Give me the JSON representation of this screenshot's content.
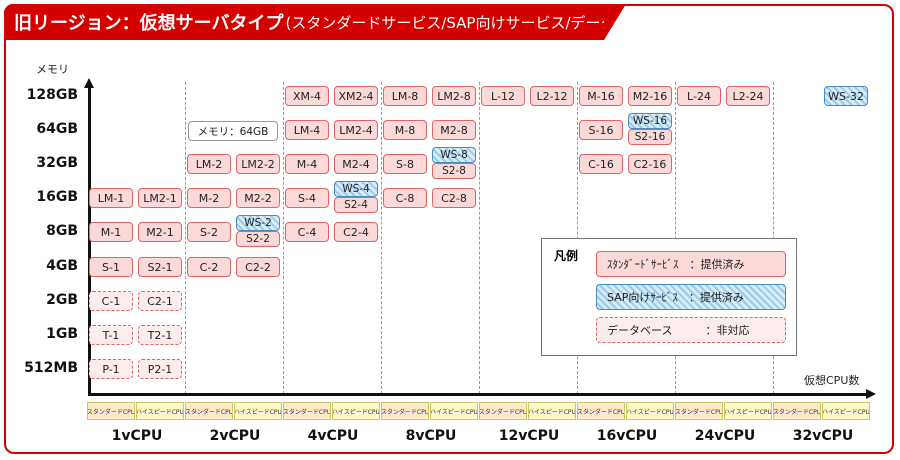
{
  "title": {
    "main": "旧リージョン：仮想サーバタイプ",
    "sub": "(スタンダードサービス/SAP向けサービス/データベース)"
  },
  "axes": {
    "y_label": "メモリ",
    "x_label": "仮想CPU数"
  },
  "memory_levels": [
    "128GB",
    "64GB",
    "32GB",
    "16GB",
    "8GB",
    "4GB",
    "2GB",
    "1GB",
    "512MB"
  ],
  "cpu_groups": [
    "1vCPU",
    "2vCPU",
    "4vCPU",
    "8vCPU",
    "12vCPU",
    "16vCPU",
    "24vCPU",
    "32vCPU"
  ],
  "cpu_subtypes": {
    "standard": "スタンダードCPU",
    "highspeed": "ハイスピードCPU"
  },
  "memory_note": "メモリ：64GB",
  "types": [
    {
      "label": "P-1",
      "kind": "db"
    },
    {
      "label": "P2-1",
      "kind": "db"
    },
    {
      "label": "T-1",
      "kind": "db"
    },
    {
      "label": "T2-1",
      "kind": "db"
    },
    {
      "label": "C-1",
      "kind": "db"
    },
    {
      "label": "C2-1",
      "kind": "db"
    },
    {
      "label": "S-1",
      "kind": "std"
    },
    {
      "label": "S2-1",
      "kind": "std"
    },
    {
      "label": "M-1",
      "kind": "std"
    },
    {
      "label": "M2-1",
      "kind": "std"
    },
    {
      "label": "LM-1",
      "kind": "std"
    },
    {
      "label": "LM2-1",
      "kind": "std"
    },
    {
      "label": "C-2",
      "kind": "std"
    },
    {
      "label": "C2-2",
      "kind": "std"
    },
    {
      "label": "S-2",
      "kind": "std"
    },
    {
      "label": "WS-2",
      "kind": "sap"
    },
    {
      "label": "S2-2",
      "kind": "std"
    },
    {
      "label": "M-2",
      "kind": "std"
    },
    {
      "label": "M2-2",
      "kind": "std"
    },
    {
      "label": "LM-2",
      "kind": "std"
    },
    {
      "label": "LM2-2",
      "kind": "std"
    },
    {
      "label": "C-4",
      "kind": "std"
    },
    {
      "label": "C2-4",
      "kind": "std"
    },
    {
      "label": "S-4",
      "kind": "std"
    },
    {
      "label": "WS-4",
      "kind": "sap"
    },
    {
      "label": "S2-4",
      "kind": "std"
    },
    {
      "label": "M-4",
      "kind": "std"
    },
    {
      "label": "M2-4",
      "kind": "std"
    },
    {
      "label": "LM-4",
      "kind": "std"
    },
    {
      "label": "LM2-4",
      "kind": "std"
    },
    {
      "label": "XM-4",
      "kind": "std"
    },
    {
      "label": "XM2-4",
      "kind": "std"
    },
    {
      "label": "C-8",
      "kind": "std"
    },
    {
      "label": "C2-8",
      "kind": "std"
    },
    {
      "label": "S-8",
      "kind": "std"
    },
    {
      "label": "WS-8",
      "kind": "sap"
    },
    {
      "label": "S2-8",
      "kind": "std"
    },
    {
      "label": "M-8",
      "kind": "std"
    },
    {
      "label": "M2-8",
      "kind": "std"
    },
    {
      "label": "LM-8",
      "kind": "std"
    },
    {
      "label": "LM2-8",
      "kind": "std"
    },
    {
      "label": "L-12",
      "kind": "std"
    },
    {
      "label": "L2-12",
      "kind": "std"
    },
    {
      "label": "C-16",
      "kind": "std"
    },
    {
      "label": "C2-16",
      "kind": "std"
    },
    {
      "label": "S-16",
      "kind": "std"
    },
    {
      "label": "WS-16",
      "kind": "sap"
    },
    {
      "label": "S2-16",
      "kind": "std"
    },
    {
      "label": "M-16",
      "kind": "std"
    },
    {
      "label": "M2-16",
      "kind": "std"
    },
    {
      "label": "L-24",
      "kind": "std"
    },
    {
      "label": "L2-24",
      "kind": "std"
    },
    {
      "label": "WS-32",
      "kind": "sap"
    }
  ],
  "legend": {
    "title": "凡例",
    "standard": "ｽﾀﾝﾀﾞｰﾄﾞｻｰﾋﾞｽ　：提供済み",
    "sap": "SAP向けｻｰﾋﾞｽ　：提供済み",
    "db": "データベース　　　：非対応"
  },
  "colors": {
    "accent": "#d40000",
    "standard_fill": "#fbd9d9",
    "standard_border": "#e06464",
    "sap_fill": "#d6ecf8",
    "sap_border": "#4a8cc2"
  }
}
